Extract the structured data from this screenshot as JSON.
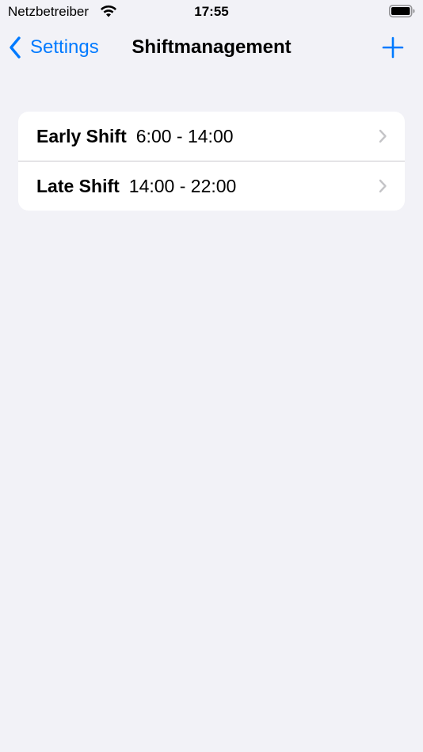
{
  "status_bar": {
    "carrier": "Netzbetreiber",
    "time": "17:55",
    "wifi_icon": "wifi-icon",
    "battery_icon": "battery-icon"
  },
  "nav": {
    "back_label": "Settings",
    "back_icon": "chevron-left-icon",
    "title": "Shiftmanagement",
    "add_icon": "plus-icon"
  },
  "shifts": [
    {
      "name": "Early Shift",
      "time": "6:00 - 14:00"
    },
    {
      "name": "Late Shift",
      "time": "14:00 - 22:00"
    }
  ],
  "colors": {
    "accent": "#007AFF",
    "background": "#F2F2F7",
    "card": "#FFFFFF",
    "chevron": "#C4C4C7"
  }
}
